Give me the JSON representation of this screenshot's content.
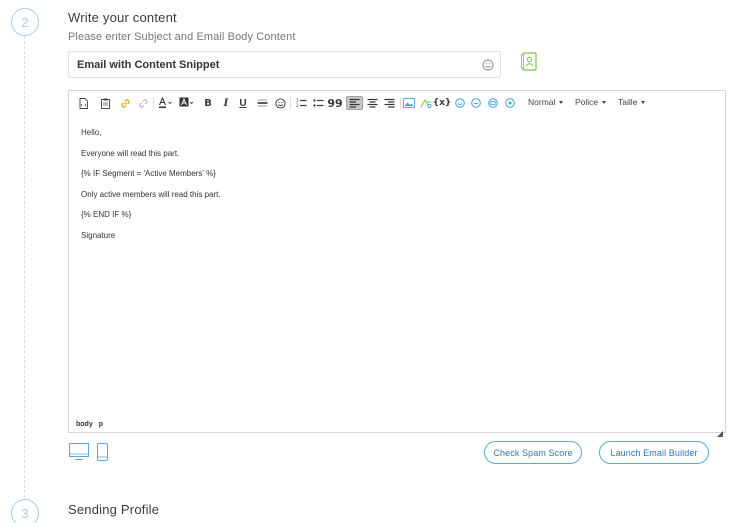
{
  "steps": {
    "step2": {
      "number": "2",
      "title": "Write your content",
      "subtitle": "Please enter Subject and Email Body Content"
    },
    "step3": {
      "number": "3",
      "title": "Sending Profile"
    }
  },
  "subject": {
    "value": "Email with Content Snippet",
    "emoji_icon": "smiley-icon"
  },
  "snippet_button": {
    "icon": "contact-card-icon",
    "color": "#7dc242"
  },
  "toolbar": {
    "bold": "B",
    "italic": "I",
    "underline": "U",
    "quote": "99",
    "variable": "{x}",
    "format_select": "Normal",
    "font_select": "Police",
    "size_select": "Taille"
  },
  "body": {
    "lines": [
      "Hello,",
      "Everyone will read this part.",
      "{% IF Segment = 'Active Members' %}",
      "Only active members will read this part.",
      "{% END IF %}",
      "Signature"
    ]
  },
  "statusbar": {
    "path": [
      "body",
      "p"
    ]
  },
  "buttons": {
    "spam": "Check Spam Score",
    "builder": "Launch Email Builder"
  },
  "colors": {
    "accent": "#5aa6e0",
    "link": "#2f77b5",
    "step": "#a9cdec",
    "snippet": "#7dc242"
  }
}
